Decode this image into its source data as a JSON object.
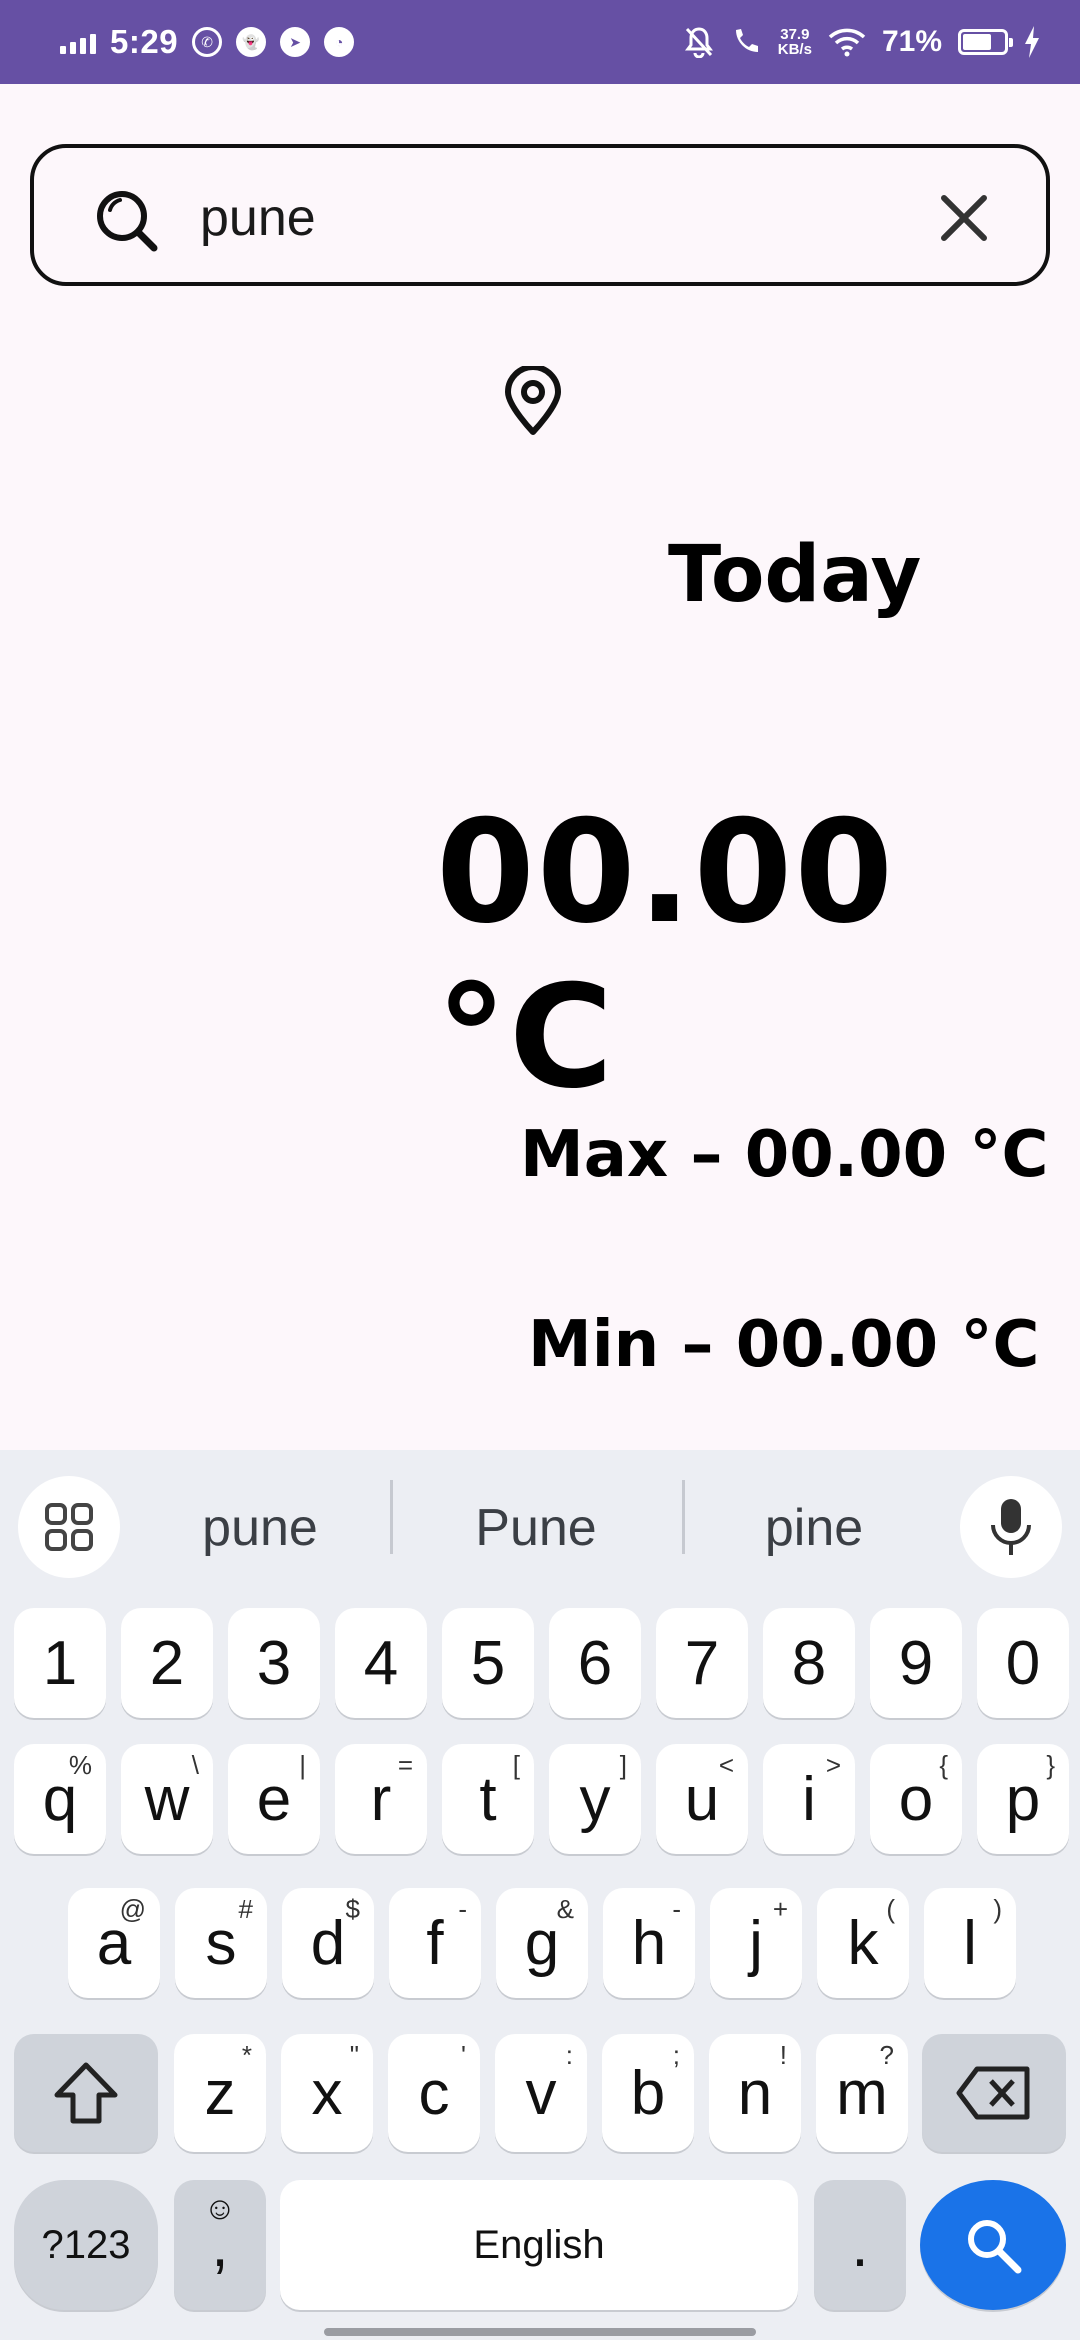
{
  "status_bar": {
    "time": "5:29",
    "network_speed_value": "37.9",
    "network_speed_unit": "KB/s",
    "battery_percent": "71%",
    "battery_level": 0.71,
    "background_color": "#6650a4"
  },
  "search": {
    "value": "pune",
    "placeholder": ""
  },
  "weather": {
    "day_label": "Today",
    "temperature": "00.00 °C",
    "max": "Max – 00.00 °C",
    "min": "Min – 00.00 °C"
  },
  "keyboard": {
    "suggestions": [
      "pune",
      "Pune",
      "pine"
    ],
    "number_row": [
      "1",
      "2",
      "3",
      "4",
      "5",
      "6",
      "7",
      "8",
      "9",
      "0"
    ],
    "row1": [
      {
        "k": "q",
        "h": "%"
      },
      {
        "k": "w",
        "h": "\\"
      },
      {
        "k": "e",
        "h": "|"
      },
      {
        "k": "r",
        "h": "="
      },
      {
        "k": "t",
        "h": "["
      },
      {
        "k": "y",
        "h": "]"
      },
      {
        "k": "u",
        "h": "<"
      },
      {
        "k": "i",
        "h": ">"
      },
      {
        "k": "o",
        "h": "{"
      },
      {
        "k": "p",
        "h": "}"
      }
    ],
    "row2": [
      {
        "k": "a",
        "h": "@"
      },
      {
        "k": "s",
        "h": "#"
      },
      {
        "k": "d",
        "h": "$"
      },
      {
        "k": "f",
        "h": "-"
      },
      {
        "k": "g",
        "h": "&"
      },
      {
        "k": "h",
        "h": "-"
      },
      {
        "k": "j",
        "h": "+"
      },
      {
        "k": "k",
        "h": "("
      },
      {
        "k": "l",
        "h": ")"
      }
    ],
    "row3": [
      {
        "k": "z",
        "h": "*"
      },
      {
        "k": "x",
        "h": "\""
      },
      {
        "k": "c",
        "h": "'"
      },
      {
        "k": "v",
        "h": ":"
      },
      {
        "k": "b",
        "h": ";"
      },
      {
        "k": "n",
        "h": "!"
      },
      {
        "k": "m",
        "h": "?"
      }
    ],
    "symbols_label": "?123",
    "comma_label": ",",
    "space_label": "English",
    "period_label": ".",
    "accent_color": "#1a73e8"
  }
}
